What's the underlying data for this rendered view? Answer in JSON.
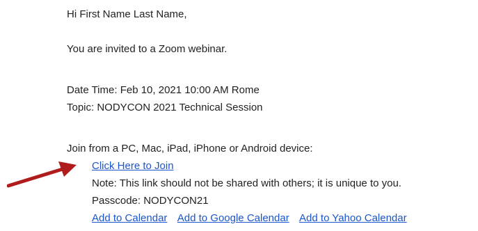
{
  "email": {
    "greeting": "Hi First Name Last Name,",
    "invitation": "You are invited to a Zoom webinar.",
    "datetime": "Date Time: Feb 10, 2021 10:00 AM Rome",
    "topic": "Topic: NODYCON 2021 Technical Session",
    "join_prompt": "Join from a PC, Mac, iPad, iPhone or Android device:",
    "join_link": "Click Here to Join",
    "note": "Note: This link should not be shared with others; it is unique to you.",
    "passcode": "Passcode: NODYCON21",
    "calendar_links": {
      "add_calendar": "Add to Calendar",
      "add_google": "Add to Google Calendar",
      "add_yahoo": "Add to Yahoo Calendar"
    }
  },
  "colors": {
    "link": "#1a55cc",
    "text": "#222222",
    "arrow": "#b01c1c"
  }
}
